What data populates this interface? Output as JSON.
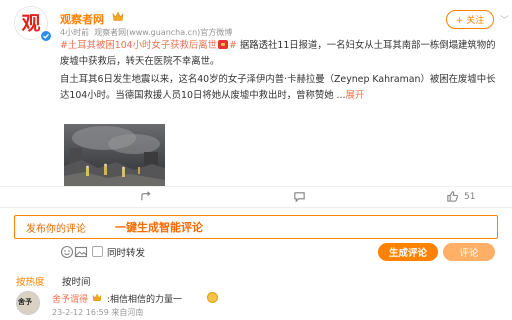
{
  "header": {
    "author": "观察者网",
    "logo_text": "观",
    "time": "4小时前",
    "source": "观察者网(www.guancha.cn)官方微博",
    "follow_label": "+ 关注",
    "more": "﹀"
  },
  "post": {
    "topic": "#土耳其被困104小时女子获救后离世",
    "topic_end": "#",
    "para1_rest": " 据路透社11日报道，一名妇女从土耳其南部一栋倒塌建筑物的废墟中获救后，转天在医院不幸离世。",
    "para2": "自土耳其6日发生地震以来，这名40岁的女子泽伊内普·卡赫拉曼（Zeynep Kahraman）被困在废墟中长达104小时。当德国救援人员10日将她从废墟中救出时，曾称赞她 ...",
    "expand": "展开"
  },
  "actions": {
    "share": "",
    "comments": "",
    "likes": "51"
  },
  "composer": {
    "placeholder": "发布你的评论",
    "ai_hint": "一键生成智能评论",
    "repost_label": "同时转发",
    "generate_button": "生成评论",
    "comment_button": "评论"
  },
  "sort": {
    "hot": "按热度",
    "time": "按时间"
  },
  "comment": {
    "avatar_text": "舍予",
    "name": "舍予谓得",
    "text": ":相信相信的力量一",
    "time": "23-2-12 16:59 来自河南"
  },
  "colors": {
    "brand": "#ff8200",
    "link": "#eb7350"
  }
}
